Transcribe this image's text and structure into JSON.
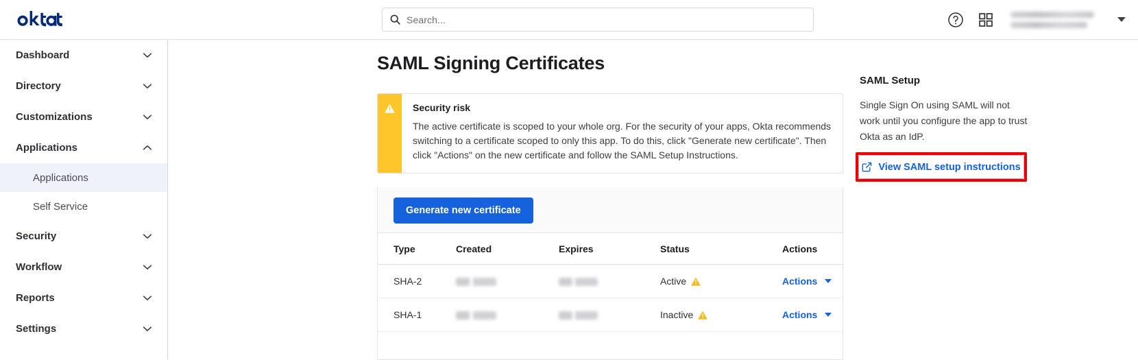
{
  "brand": {
    "logo_text": "okta",
    "logo_color": "#00297a"
  },
  "topbar": {
    "search": {
      "placeholder": "Search...",
      "value": "",
      "icon": "search-icon"
    },
    "help_icon": "help-circle-icon",
    "apps_icon": "grid-apps-icon",
    "user_menu": {
      "line1": "",
      "line2": "",
      "caret_icon": "chevron-down-icon"
    }
  },
  "sidebar": {
    "items": [
      {
        "label": "Dashboard",
        "type": "group",
        "expanded": false,
        "active": false
      },
      {
        "label": "Directory",
        "type": "group",
        "expanded": false,
        "active": false
      },
      {
        "label": "Customizations",
        "type": "group",
        "expanded": false,
        "active": false
      },
      {
        "label": "Applications",
        "type": "group",
        "expanded": true,
        "active": false
      },
      {
        "label": "Applications",
        "type": "child",
        "expanded": false,
        "active": true
      },
      {
        "label": "Self Service",
        "type": "child",
        "expanded": false,
        "active": false
      },
      {
        "label": "Security",
        "type": "group",
        "expanded": false,
        "active": false
      },
      {
        "label": "Workflow",
        "type": "group",
        "expanded": false,
        "active": false
      },
      {
        "label": "Reports",
        "type": "group",
        "expanded": false,
        "active": false
      },
      {
        "label": "Settings",
        "type": "group",
        "expanded": false,
        "active": false
      }
    ]
  },
  "main": {
    "page_title": "SAML Signing Certificates",
    "alert": {
      "icon": "warning-triangle-icon",
      "accent_color": "#ffc62c",
      "title": "Security risk",
      "body": "The active certificate is scoped to your whole org. For the security of your apps, Okta recommends switching to a certificate scoped to only this app. To do this, click \"Generate new certificate\". Then click \"Actions\" on the new certificate and follow the SAML Setup Instructions."
    },
    "table": {
      "generate_button": "Generate new certificate",
      "columns": [
        "Type",
        "Created",
        "Expires",
        "Status",
        "Actions"
      ],
      "rows": [
        {
          "type": "SHA-2",
          "created": "",
          "expires": "",
          "status": "Active",
          "status_icon": "warning-triangle-icon",
          "actions_label": "Actions",
          "actions_caret": "caret-down-icon"
        },
        {
          "type": "SHA-1",
          "created": "",
          "expires": "",
          "status": "Inactive",
          "status_icon": "warning-triangle-icon",
          "actions_label": "Actions",
          "actions_caret": "caret-down-icon"
        }
      ]
    }
  },
  "right_panel": {
    "title": "SAML Setup",
    "description": "Single Sign On using SAML will not work until you configure the app to trust Okta as an IdP.",
    "button": {
      "label": "View SAML setup instructions",
      "icon": "external-link-icon"
    },
    "highlight_color": "#ee0000"
  },
  "colors": {
    "primary_blue": "#1662dd",
    "alert_amber": "#ffc62c",
    "brand_navy": "#00297a",
    "annotation_red": "#ee0000"
  }
}
